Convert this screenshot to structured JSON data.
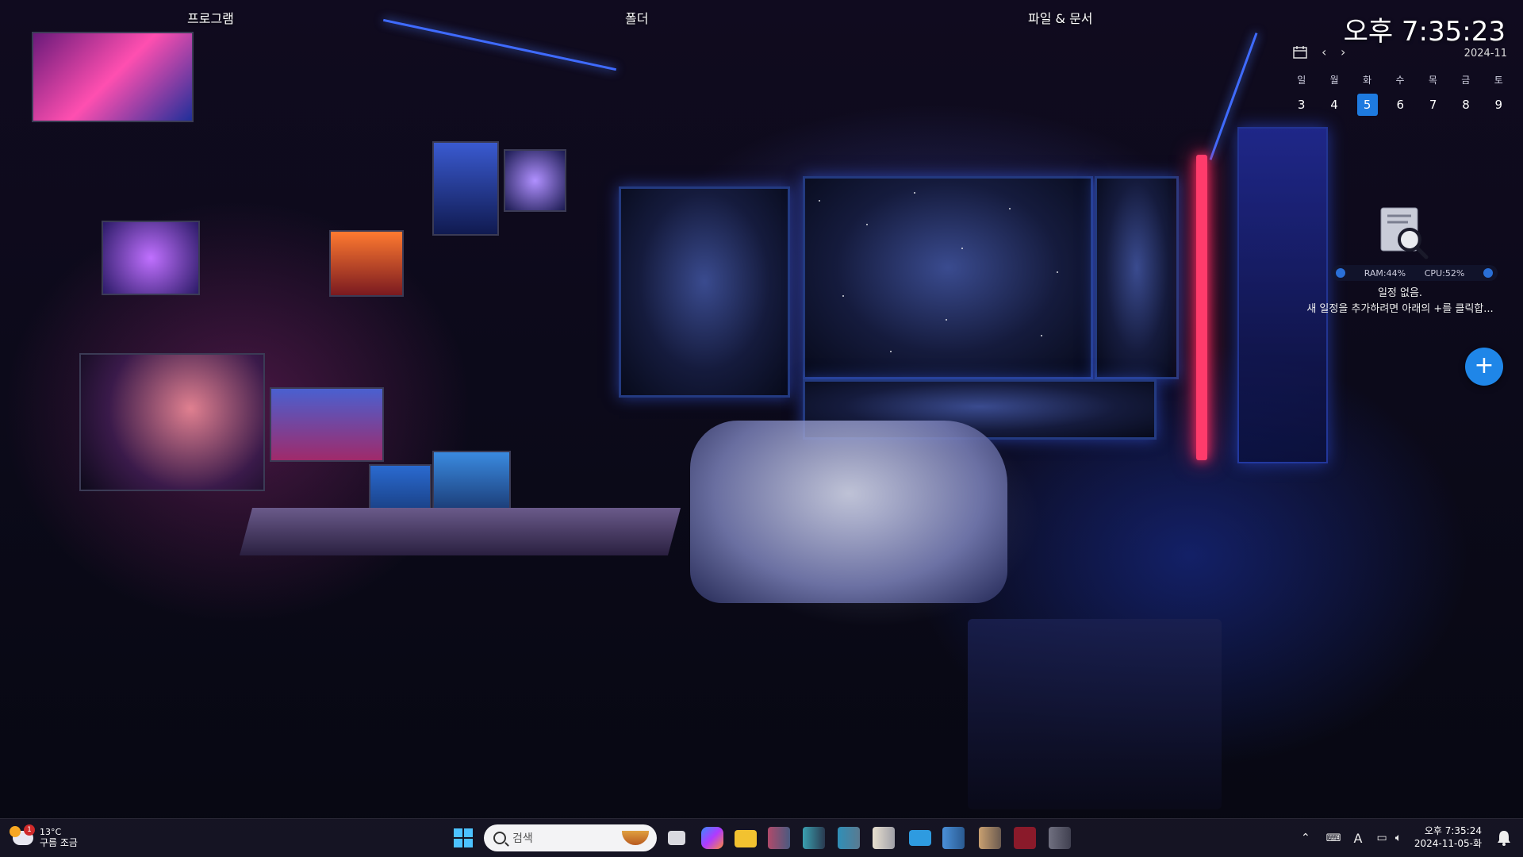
{
  "desktop": {
    "labels": {
      "programs": "프로그램",
      "folder": "폴더",
      "files_docs": "파일 & 문서"
    }
  },
  "clock_widget": {
    "time": "오후 7:35:23",
    "month": "2024-11",
    "weekdays": [
      "일",
      "월",
      "화",
      "수",
      "목",
      "금",
      "토"
    ],
    "dates": [
      "3",
      "4",
      "5",
      "6",
      "7",
      "8",
      "9"
    ],
    "today": "5",
    "nav_prev": "‹",
    "nav_next": "›"
  },
  "schedule_widget": {
    "ram": "RAM:44%",
    "cpu": "CPU:52%",
    "empty_title": "일정 없음.",
    "empty_hint": "새 일정을 추가하려면 아래의 +를 클릭합...",
    "add_label": "+"
  },
  "taskbar": {
    "weather": {
      "temp": "13°C",
      "condition": "구름 조금",
      "badge": "1"
    },
    "search_placeholder": "검색",
    "apps": [
      {
        "name": "task-view-icon",
        "color": "#d9d9e0"
      },
      {
        "name": "copilot-icon",
        "color": "#7a5cff"
      },
      {
        "name": "file-explorer-icon",
        "color": "#f2c230"
      },
      {
        "name": "pinned-app-1-icon",
        "color": "#b04a6a"
      },
      {
        "name": "pinned-app-2-icon",
        "color": "#3aa0b0"
      },
      {
        "name": "pinned-app-3-icon",
        "color": "#2f8fb8"
      },
      {
        "name": "pinned-app-4-icon",
        "color": "#e8e0d0"
      },
      {
        "name": "pinned-app-5-icon",
        "color": "#2e9be0"
      },
      {
        "name": "pinned-app-6-icon",
        "color": "#4a90d9"
      },
      {
        "name": "pinned-app-7-icon",
        "color": "#c9a070"
      },
      {
        "name": "pinned-app-8-icon",
        "color": "#8a1a2a"
      },
      {
        "name": "pinned-app-9-icon",
        "color": "#707080"
      }
    ],
    "tray": {
      "keyboard_lang": "A",
      "clock_time": "오후 7:35:24",
      "clock_date": "2024-11-05-화"
    }
  },
  "colors": {
    "accent": "#1e7be0",
    "taskbar_bg": "#181626"
  }
}
